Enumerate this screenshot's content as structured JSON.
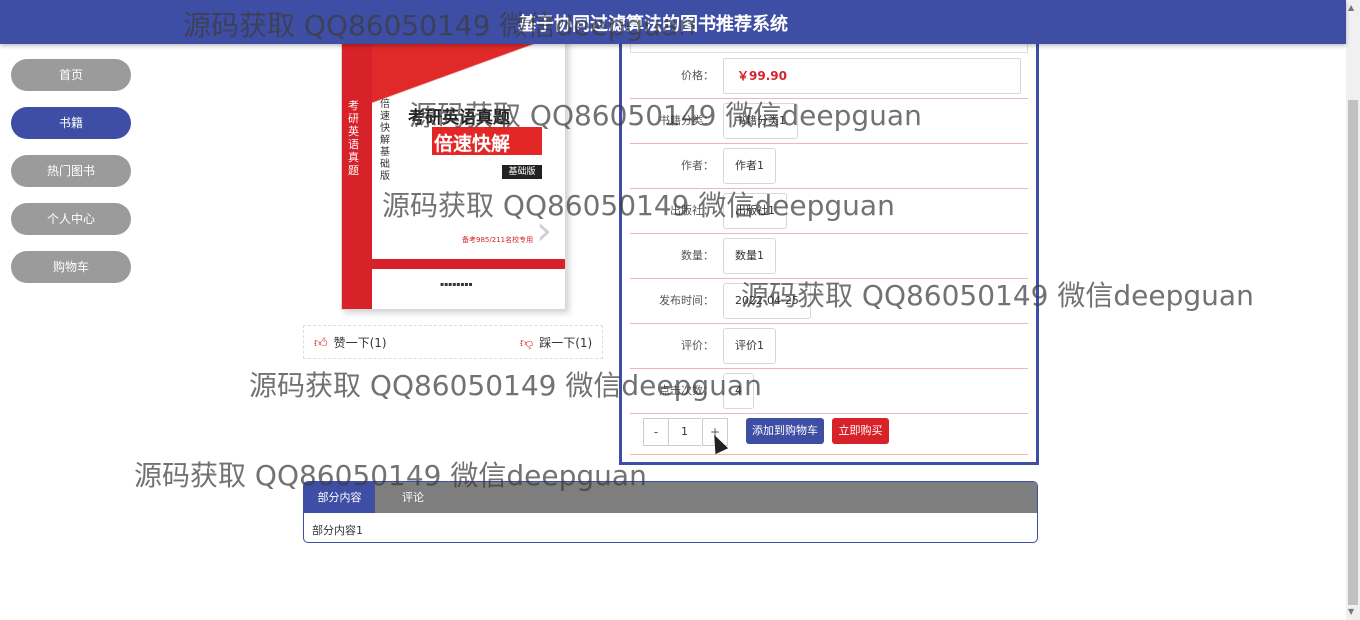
{
  "header": {
    "title": "基于协同过滤算法的图书推荐系统"
  },
  "sidebar": {
    "items": [
      {
        "label": "首页"
      },
      {
        "label": "书籍"
      },
      {
        "label": "热门图书"
      },
      {
        "label": "个人中心"
      },
      {
        "label": "购物车"
      }
    ],
    "active_index": 1
  },
  "book_cover": {
    "series": "考研英语真题",
    "title": "倍速快解",
    "edition": "基础版",
    "side_text": "考研英语真题",
    "side_text2": "倍速快解 基础版",
    "tag": "备考985/211名校专用"
  },
  "votes": {
    "like_label": "赞一下(1)",
    "dislike_label": "踩一下(1)"
  },
  "details": {
    "price_label": "价格：",
    "price_value": "￥99.90",
    "category_label": "书籍分类：",
    "category_value": "书籍分类1",
    "author_label": "作者：",
    "author_value": "作者1",
    "publisher_label": "出版社：",
    "publisher_value": "出版社1",
    "quantity_label": "数量：",
    "quantity_value": "数量1",
    "publish_date_label": "发布时间：",
    "publish_date_value": "2022-04-25",
    "rating_label": "评价：",
    "rating_value": "评价1",
    "clicks_label": "点击次数：",
    "clicks_value": "4"
  },
  "purchase": {
    "minus": "-",
    "qty": "1",
    "plus": "+",
    "add_to_cart": "添加到购物车",
    "buy_now": "立即购买"
  },
  "tabs": {
    "items": [
      {
        "label": "部分内容"
      },
      {
        "label": "评论"
      }
    ],
    "content": "部分内容1"
  },
  "watermark": {
    "text1": "源码获取 QQ86050149 微信deepguan",
    "text2": "源码获取 QQ86050149 微信deepguan",
    "text3": "源码获取 QQ86050149 微信deepguan",
    "text4": "源码获取 QQ86050149 微信deepguan",
    "text5": "源码获取 QQ86050149 微信deepguan",
    "text6": "源码获取 QQ86050149 微信deepguan"
  },
  "colors": {
    "primary": "#3f4ea5",
    "danger": "#d72229",
    "nav_inactive": "#9b9b9b"
  }
}
